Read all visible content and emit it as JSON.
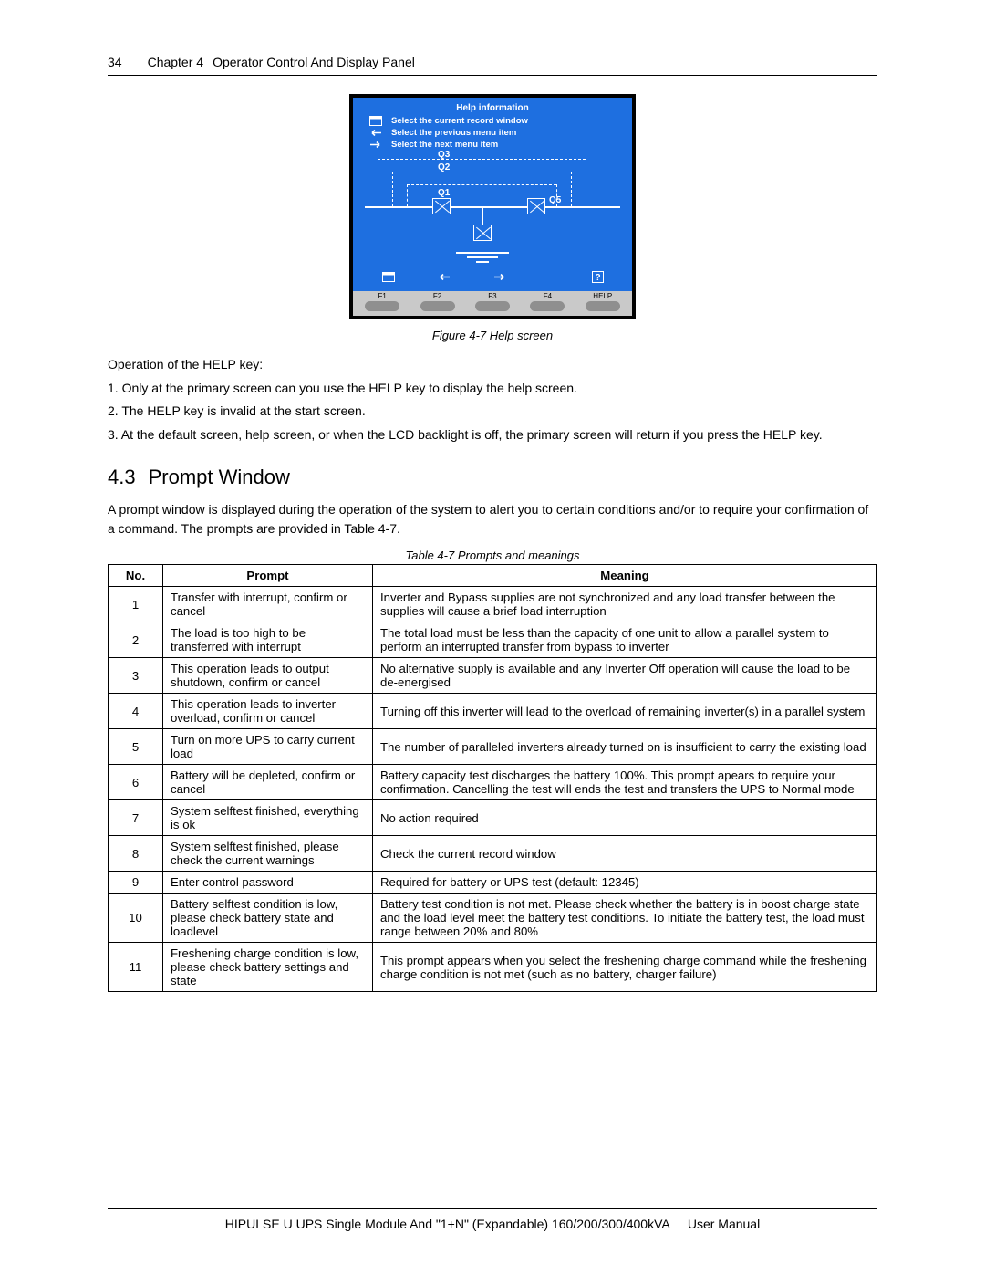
{
  "header": {
    "page_number": "34",
    "chapter": "Chapter 4",
    "chapter_title": "Operator Control And Display Panel"
  },
  "lcd": {
    "title": "Help information",
    "rows": [
      {
        "icon": "window-icon",
        "text": "Select the current record window"
      },
      {
        "icon": "arrow-left-icon",
        "text": "Select the previous menu item"
      },
      {
        "icon": "arrow-right-icon",
        "text": "Select the next menu item"
      }
    ],
    "q_labels": [
      "Q1",
      "Q2",
      "Q3",
      "Q5"
    ],
    "fkeys": [
      "F1",
      "F2",
      "F3",
      "F4",
      "HELP"
    ]
  },
  "figure_caption": "Figure 4-7   Help screen",
  "body": {
    "p0": "Operation of the HELP key:",
    "p1": "1. Only at the primary screen can you use the HELP key to display the help screen.",
    "p2": "2. The HELP key is invalid at the start screen.",
    "p3": "3. At the default screen, help screen, or when the LCD backlight is off, the primary screen will return if you press the HELP key."
  },
  "section": {
    "number": "4.3",
    "title": "Prompt Window"
  },
  "section_intro": "A prompt window is displayed during the operation of the system to alert you to certain conditions and/or to require your confirmation of a command. The prompts are provided in Table 4-7.",
  "table_caption": "Table 4-7   Prompts and meanings",
  "table_headers": {
    "no": "No.",
    "prompt": "Prompt",
    "meaning": "Meaning"
  },
  "prompts": [
    {
      "no": "1",
      "prompt": "Transfer with interrupt, confirm or cancel",
      "meaning": "Inverter and Bypass supplies are not synchronized and any load transfer between the supplies will cause a brief load interruption"
    },
    {
      "no": "2",
      "prompt": "The load is too high to be transferred with interrupt",
      "meaning": "The total load must be less than the capacity of one unit to allow a parallel system to perform an interrupted transfer from bypass to inverter"
    },
    {
      "no": "3",
      "prompt": "This operation leads to output shutdown, confirm or cancel",
      "meaning": "No alternative supply is available and any Inverter Off operation will cause the load to be de-energised"
    },
    {
      "no": "4",
      "prompt": "This operation leads to inverter overload, confirm or cancel",
      "meaning": "Turning off this inverter will lead to the overload of remaining inverter(s) in a parallel system"
    },
    {
      "no": "5",
      "prompt": "Turn on more UPS to carry current load",
      "meaning": "The number of paralleled inverters already turned on is insufficient to carry the existing load"
    },
    {
      "no": "6",
      "prompt": "Battery will be depleted, confirm or cancel",
      "meaning": "Battery capacity test discharges the battery 100%. This prompt apears to require your confirmation. Cancelling the test will ends the test and transfers the UPS to Normal mode"
    },
    {
      "no": "7",
      "prompt": "System selftest finished, everything is ok",
      "meaning": "No action required"
    },
    {
      "no": "8",
      "prompt": "System selftest finished, please check the current warnings",
      "meaning": "Check the current record window"
    },
    {
      "no": "9",
      "prompt": "Enter control password",
      "meaning": "Required for battery or UPS test (default: 12345)"
    },
    {
      "no": "10",
      "prompt": "Battery selftest condition is low, please check battery state and loadlevel",
      "meaning": "Battery test condition is not met. Please check whether the battery is in boost charge state and the load level meet the battery test conditions. To initiate the battery test, the load must range between 20% and 80%"
    },
    {
      "no": "11",
      "prompt": "Freshening charge condition is low, please check battery settings and state",
      "meaning": "This prompt appears when you select the freshening charge command while the freshening charge condition is not met (such as no battery, charger failure)"
    }
  ],
  "footer": {
    "product": "HIPULSE U UPS Single Module And \"1+N\" (Expandable) 160/200/300/400kVA",
    "doc": "User Manual"
  }
}
